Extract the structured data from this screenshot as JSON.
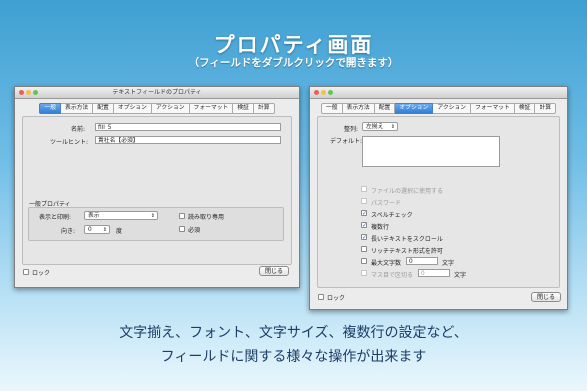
{
  "header": {
    "title": "プロパティ画面",
    "subtitle": "（フィールドをダブルクリックで開きます）"
  },
  "caption": {
    "line1": "文字揃え、フォント、文字サイズ、複数行の設定など、",
    "line2": "フィールドに関する様々な操作が出来ます"
  },
  "left_window": {
    "title": "テキストフィールドのプロパティ",
    "tabs": [
      "一般",
      "表示方法",
      "配置",
      "オプション",
      "アクション",
      "フォーマット",
      "検証",
      "計算"
    ],
    "active_tab": "一般",
    "name_label": "名前:",
    "name_value": "fill_5",
    "tooltip_label": "ツールヒント:",
    "tooltip_value": "貴社名【必須】",
    "group_title": "一般プロパティ",
    "display_label": "表示と印刷:",
    "display_value": "表示",
    "orientation_label": "向き:",
    "orientation_value": "0",
    "orientation_unit": "度",
    "readonly_label": "読み取り専用",
    "required_label": "必須",
    "lock_label": "ロック",
    "close_label": "閉じる"
  },
  "right_window": {
    "tabs": [
      "一般",
      "表示方法",
      "配置",
      "オプション",
      "アクション",
      "フォーマット",
      "検証",
      "計算"
    ],
    "active_tab": "オプション",
    "align_label": "整列:",
    "align_value": "左揃え",
    "default_label": "デフォルト:",
    "default_value": "",
    "options": [
      {
        "label": "ファイルの選択に使用する",
        "checked": false,
        "disabled": true
      },
      {
        "label": "パスワード",
        "checked": false,
        "disabled": true
      },
      {
        "label": "スペルチェック",
        "checked": true,
        "disabled": false
      },
      {
        "label": "複数行",
        "checked": true,
        "disabled": false
      },
      {
        "label": "長いテキストをスクロール",
        "checked": true,
        "disabled": false
      },
      {
        "label": "リッチテキスト形式を許可",
        "checked": false,
        "disabled": false
      },
      {
        "label": "最大文字数",
        "checked": false,
        "disabled": false
      },
      {
        "label": "マス目で区切る",
        "checked": false,
        "disabled": true
      }
    ],
    "maxchars_value": "0",
    "maxchars_unit": "文字",
    "comb_value": "0",
    "comb_unit": "文字",
    "lock_label": "ロック",
    "close_label": "閉じる"
  },
  "colors": {
    "accent": "#2f7fd9",
    "caption": "#1b3d66"
  }
}
